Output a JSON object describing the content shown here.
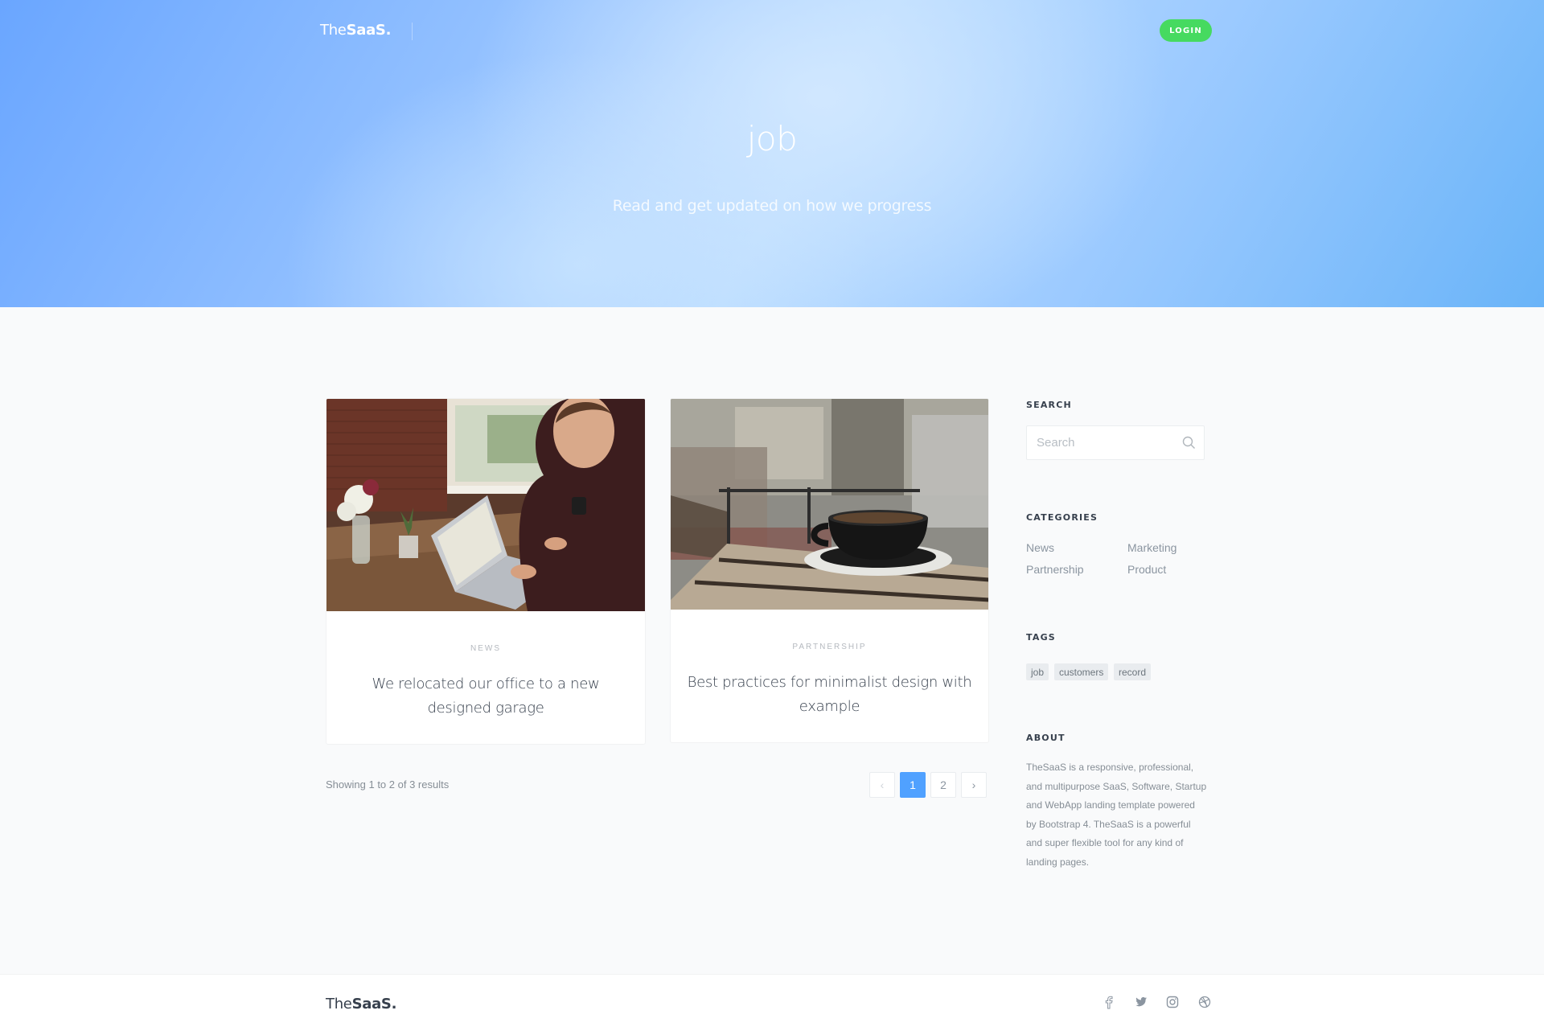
{
  "brand": {
    "logo_light": "The",
    "logo_bold": "SaaS."
  },
  "nav": {
    "login_label": "LOGIN"
  },
  "hero": {
    "title": "job",
    "subtitle": "Read and get updated on how we progress"
  },
  "posts": [
    {
      "category": "NEWS",
      "title": "We relocated our office to a new designed garage",
      "image": "laptop-desk-photo"
    },
    {
      "category": "PARTNERSHIP",
      "title": "Best practices for minimalist design with example",
      "image": "coffee-cup-photo"
    }
  ],
  "pagination": {
    "summary": "Showing 1 to 2 of 3 results",
    "prev": "‹",
    "pages": [
      "1",
      "2"
    ],
    "current": "1",
    "next": "›"
  },
  "sidebar": {
    "search": {
      "heading": "SEARCH",
      "placeholder": "Search"
    },
    "categories": {
      "heading": "CATEGORIES",
      "items": [
        "News",
        "Marketing",
        "Partnership",
        "Product"
      ]
    },
    "tags": {
      "heading": "TAGS",
      "items": [
        "job",
        "customers",
        "record"
      ]
    },
    "about": {
      "heading": "ABOUT",
      "text": "TheSaaS is a responsive, professional, and multipurpose SaaS, Software, Startup and WebApp landing template powered by Bootstrap 4. TheSaaS is a powerful and super flexible tool for any kind of landing pages."
    }
  },
  "footer": {
    "social": [
      "facebook-icon",
      "twitter-icon",
      "instagram-icon",
      "dribbble-icon"
    ]
  },
  "colors": {
    "accent": "#50a1ff",
    "login": "#46da60",
    "heading": "#37404d",
    "text": "#868e96"
  }
}
